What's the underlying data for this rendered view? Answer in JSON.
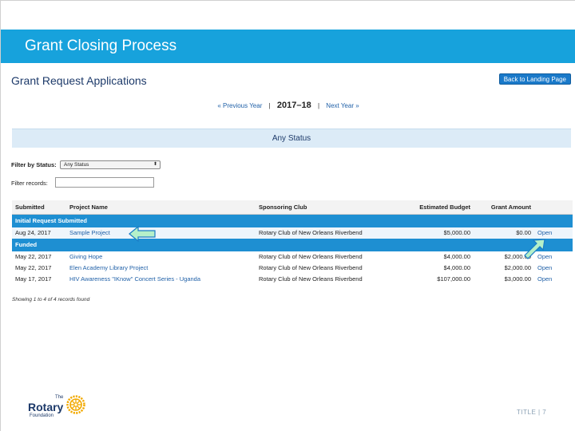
{
  "slide": {
    "title": "Grant Closing Process",
    "footer": "TITLE | 7"
  },
  "app": {
    "title": "Grant Request Applications",
    "landing_button": "Back to Landing Page",
    "prev_year": "« Previous Year",
    "current_year": "2017–18",
    "next_year": "Next Year »",
    "status_heading": "Any Status",
    "filter_status_label": "Filter by Status:",
    "filter_status_value": "Any Status",
    "filter_records_label": "Filter records:",
    "filter_records_value": "",
    "records_found": "Showing 1 to 4 of 4 records found"
  },
  "table": {
    "headers": [
      "Submitted",
      "Project Name",
      "Sponsoring Club",
      "Estimated Budget",
      "Grant Amount",
      ""
    ],
    "groups": [
      {
        "label": "Initial Request Submitted",
        "rows": [
          {
            "submitted": "Aug 24, 2017",
            "project": "Sample Project",
            "club": "Rotary Club of New Orleans Riverbend",
            "budget": "$5,000.00",
            "grant": "$0.00",
            "action": "Open"
          }
        ]
      },
      {
        "label": "Funded",
        "rows": [
          {
            "submitted": "May 22, 2017",
            "project": "Giving Hope",
            "club": "Rotary Club of New Orleans Riverbend",
            "budget": "$4,000.00",
            "grant": "$2,000.00",
            "action": "Open"
          },
          {
            "submitted": "May 22, 2017",
            "project": "Elen Academy Library Project",
            "club": "Rotary Club of New Orleans Riverbend",
            "budget": "$4,000.00",
            "grant": "$2,000.00",
            "action": "Open"
          },
          {
            "submitted": "May 17, 2017",
            "project": "HIV Awareness \"IKnow\" Concert Series - Uganda",
            "club": "Rotary Club of New Orleans Riverbend",
            "budget": "$107,000.00",
            "grant": "$3,000.00",
            "action": "Open"
          }
        ]
      }
    ]
  },
  "logo": {
    "the": "The",
    "name": "Rotary",
    "foundation": "Foundation"
  },
  "colors": {
    "title_band": "#17a2dc",
    "group_row": "#1e8fd2",
    "arrow_fill": "#b5f0c9",
    "arrow_stroke": "#1a7cc6"
  }
}
